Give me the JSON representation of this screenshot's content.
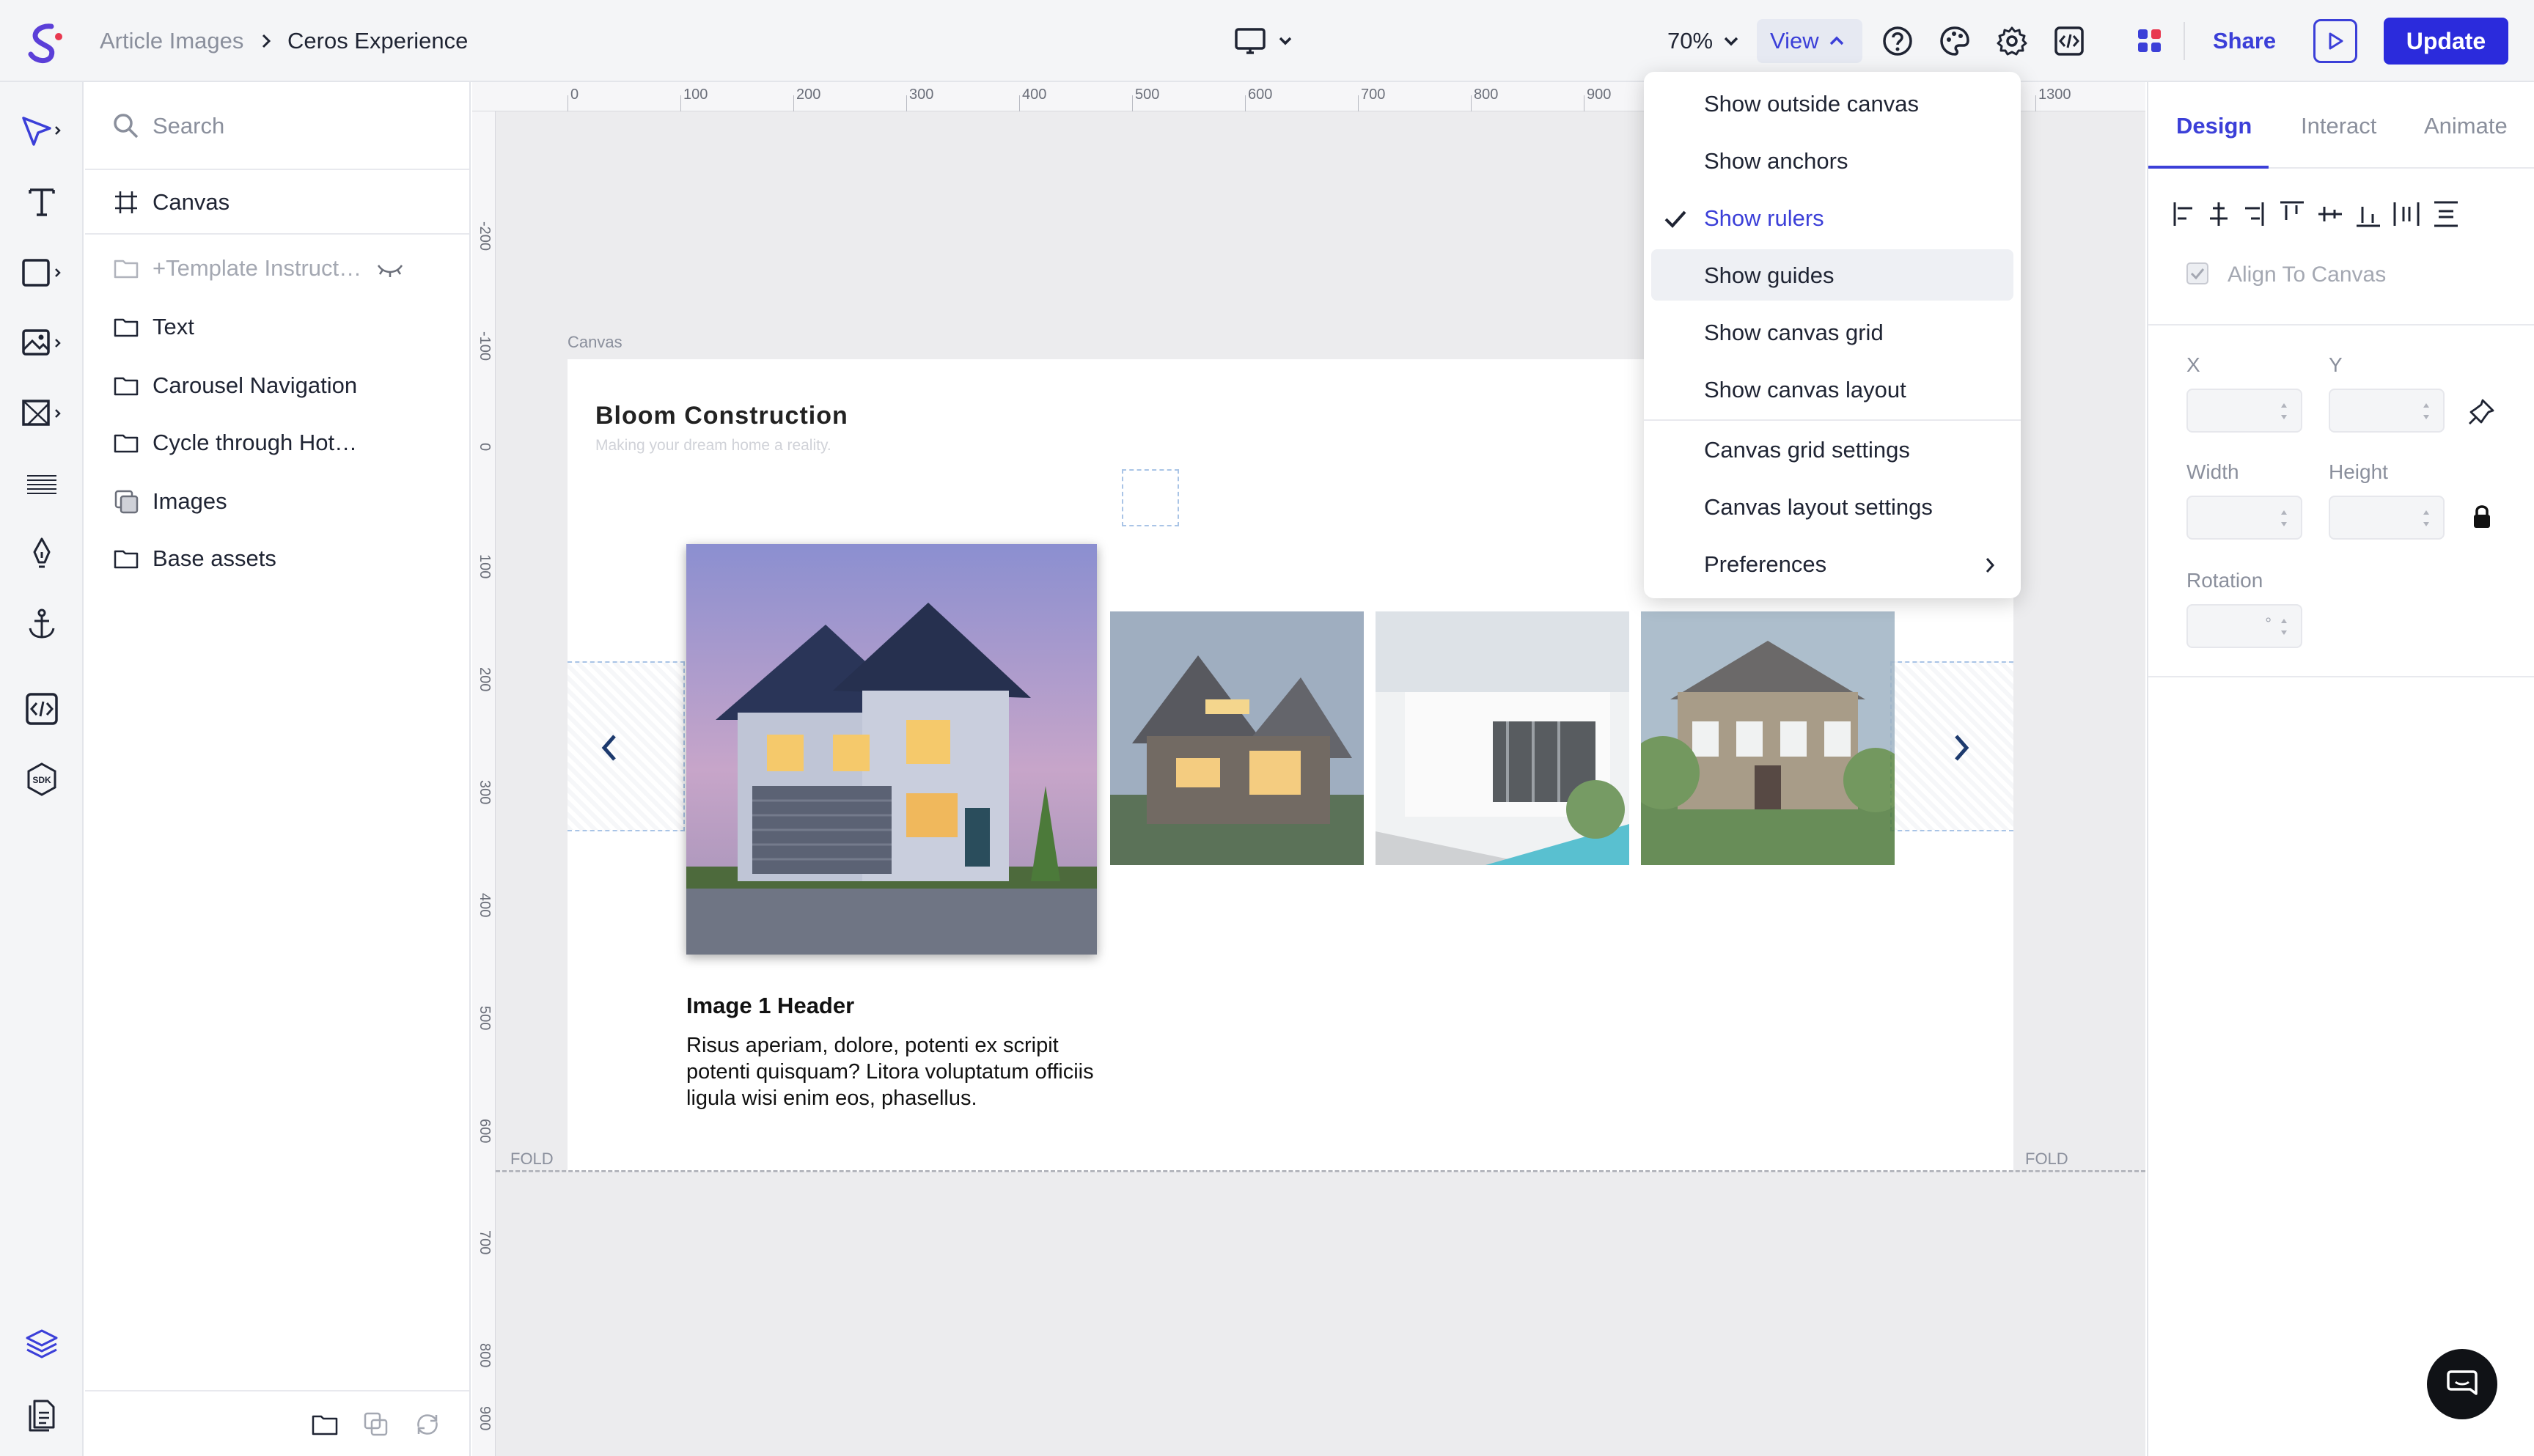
{
  "breadcrumb": {
    "parent": "Article Images",
    "current": "Ceros Experience"
  },
  "toolbar": {
    "zoom": "70%",
    "view_label": "View",
    "share_label": "Share",
    "update_label": "Update"
  },
  "search": {
    "placeholder": "Search"
  },
  "layers": [
    {
      "label": "Canvas"
    },
    {
      "label": "+Template Instruct…"
    },
    {
      "label": "Text"
    },
    {
      "label": "Carousel Navigation"
    },
    {
      "label": "Cycle through Hot…"
    },
    {
      "label": "Images"
    },
    {
      "label": "Base assets"
    }
  ],
  "ruler": {
    "top": [
      "0",
      "100",
      "200",
      "300",
      "400",
      "500",
      "600",
      "700",
      "800",
      "900",
      "1300"
    ],
    "left": [
      "-200",
      "-100",
      "0",
      "100",
      "200",
      "300",
      "400",
      "500",
      "600",
      "700",
      "800",
      "900"
    ]
  },
  "canvas": {
    "tag": "Canvas",
    "fold_label": "FOLD",
    "brand_title": "Bloom Construction",
    "brand_subtitle": "Making your dream home a reality.",
    "card_header": "Image 1 Header",
    "card_body": "Risus aperiam, dolore, potenti ex scripit potenti quisquam? Litora voluptatum officiis ligula wisi enim eos, phasellus."
  },
  "view_menu": {
    "items": [
      {
        "label": "Show outside canvas"
      },
      {
        "label": "Show anchors"
      },
      {
        "label": "Show rulers",
        "checked": true
      },
      {
        "label": "Show guides"
      },
      {
        "label": "Show canvas grid"
      },
      {
        "label": "Show canvas layout"
      },
      {
        "label": "Canvas grid settings"
      },
      {
        "label": "Canvas layout settings"
      },
      {
        "label": "Preferences"
      }
    ]
  },
  "panel": {
    "tabs": [
      "Design",
      "Interact",
      "Animate"
    ],
    "align_to_canvas": "Align To Canvas",
    "x_label": "X",
    "y_label": "Y",
    "width_label": "Width",
    "height_label": "Height",
    "rotation_label": "Rotation",
    "rotation_unit": "°"
  },
  "colors": {
    "accent": "#3b3fd8",
    "update_bg": "#2b2bdc",
    "brand_red": "#e8384f"
  }
}
